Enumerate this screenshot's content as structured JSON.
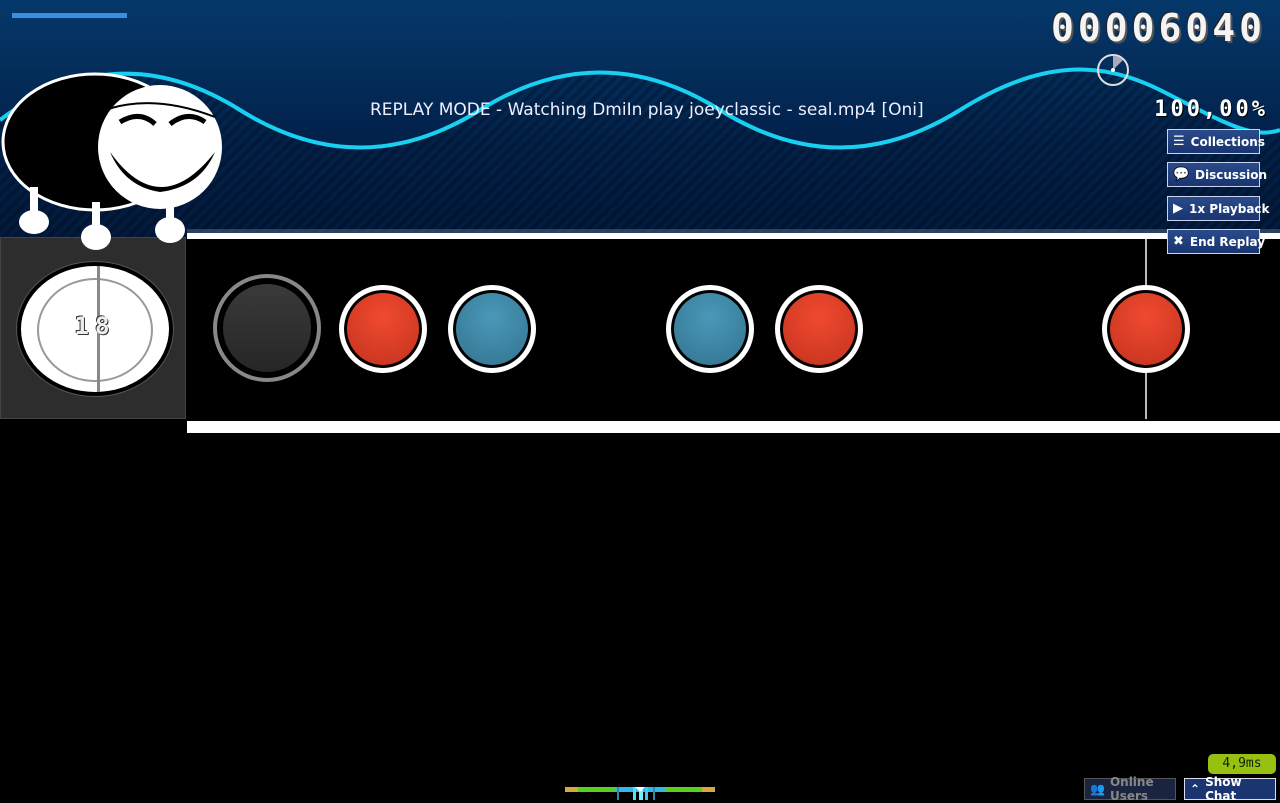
{
  "header": {
    "title": "REPLAY MODE - Watching DmiIn play joeyclassic - seal.mp4 [Oni]",
    "score": "00006040",
    "accuracy": "100,00%",
    "song_progress_percent": 8,
    "timer_elapsed_fraction": 0.12
  },
  "buttons": [
    {
      "label": "Collections",
      "icon": "list-icon"
    },
    {
      "label": "Discussion",
      "icon": "speech-bubbles-icon"
    },
    {
      "label": "1x Playback",
      "icon": "play-icon"
    },
    {
      "label": "End Replay",
      "icon": "x-icon"
    }
  ],
  "playfield": {
    "combo": "18",
    "notes": [
      {
        "type": "don"
      },
      {
        "type": "kat"
      },
      {
        "type": "kat"
      },
      {
        "type": "don"
      },
      {
        "type": "don"
      }
    ]
  },
  "footer": {
    "latency": "4,9ms",
    "online_users": "Online Users",
    "show_chat": "Show Chat"
  },
  "colors": {
    "don": "#e0402a",
    "kat": "#4088a8",
    "wave": "#1ad0f0",
    "accent": "#98c010"
  }
}
